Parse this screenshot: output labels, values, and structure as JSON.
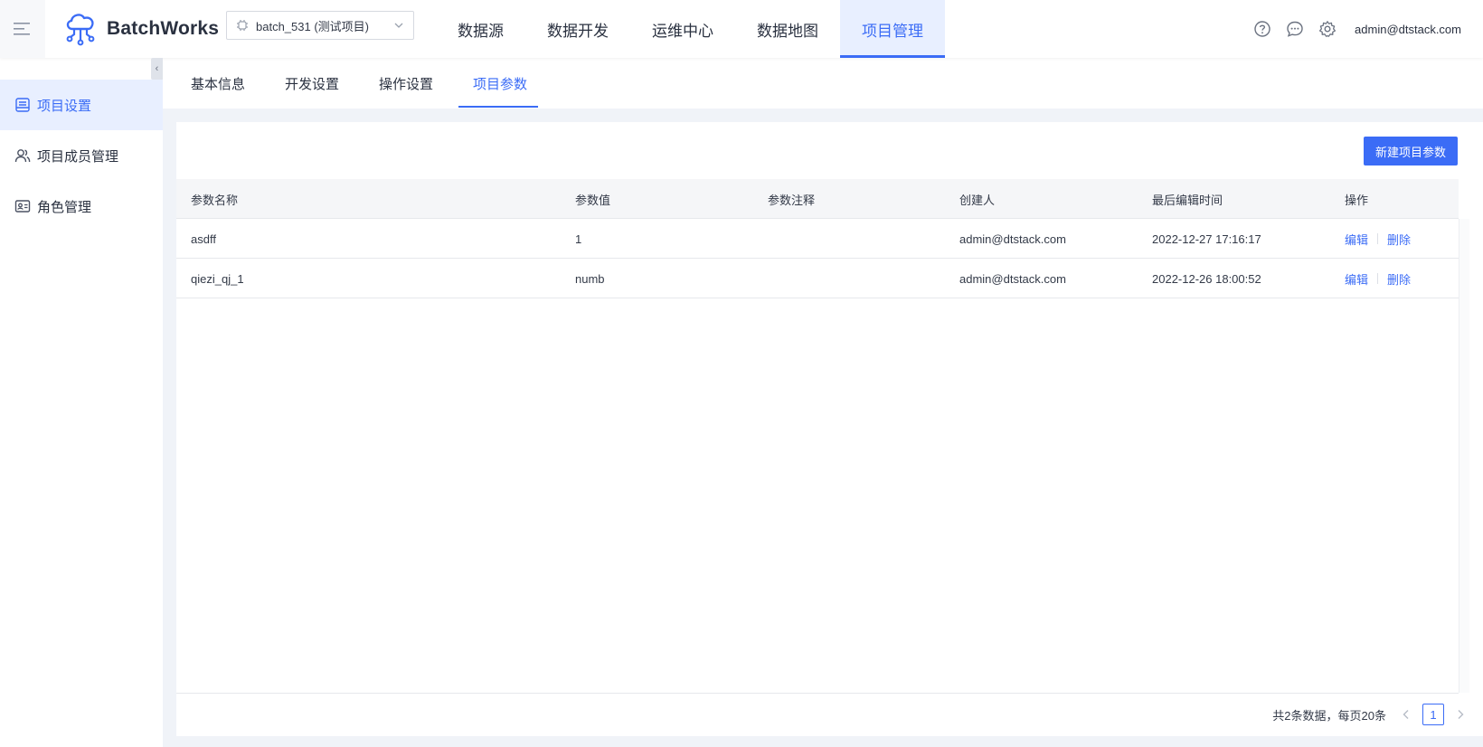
{
  "header": {
    "brand": "BatchWorks",
    "project_selector": "batch_531 (测试项目)",
    "nav": [
      {
        "label": "数据源",
        "active": false
      },
      {
        "label": "数据开发",
        "active": false
      },
      {
        "label": "运维中心",
        "active": false
      },
      {
        "label": "数据地图",
        "active": false
      },
      {
        "label": "项目管理",
        "active": true
      }
    ],
    "user": "admin@dtstack.com",
    "icons": [
      "help-icon",
      "message-icon",
      "settings-icon"
    ]
  },
  "sidebar": {
    "items": [
      {
        "label": "项目设置",
        "icon": "project-settings-icon",
        "active": true
      },
      {
        "label": "项目成员管理",
        "icon": "members-icon",
        "active": false
      },
      {
        "label": "角色管理",
        "icon": "role-icon",
        "active": false
      }
    ]
  },
  "subtabs": [
    {
      "label": "基本信息",
      "active": false
    },
    {
      "label": "开发设置",
      "active": false
    },
    {
      "label": "操作设置",
      "active": false
    },
    {
      "label": "项目参数",
      "active": true
    }
  ],
  "toolbar": {
    "new_button": "新建项目参数"
  },
  "table": {
    "columns": [
      "参数名称",
      "参数值",
      "参数注释",
      "创建人",
      "最后编辑时间",
      "操作"
    ],
    "rows": [
      {
        "name": "asdff",
        "value": "1",
        "comment": "",
        "creator": "admin@dtstack.com",
        "updated": "2022-12-27 17:16:17",
        "edit": "编辑",
        "delete": "删除"
      },
      {
        "name": "qiezi_qj_1",
        "value": "numb",
        "comment": "",
        "creator": "admin@dtstack.com",
        "updated": "2022-12-26 18:00:52",
        "edit": "编辑",
        "delete": "删除"
      }
    ]
  },
  "pagination": {
    "total_text": "共2条数据，每页20条",
    "current_page": "1"
  },
  "colors": {
    "accent": "#3b6cf6",
    "background": "#f0f3f8"
  }
}
